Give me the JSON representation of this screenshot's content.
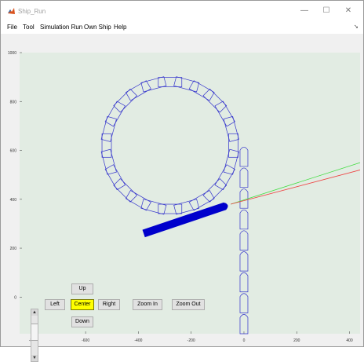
{
  "window": {
    "title": "Ship_Run",
    "controls": {
      "minimize": "—",
      "maximize": "☐",
      "close": "✕"
    }
  },
  "menu": {
    "items": [
      "File",
      "Tool",
      "Simulation Run",
      "Own Ship",
      "Help"
    ],
    "toolbar_arrow": "➘"
  },
  "controls": {
    "up": "Up",
    "left": "Left",
    "center": "Center",
    "right": "Right",
    "down": "Down",
    "zoom_in": "Zoom In",
    "zoom_out": "Zoom Out",
    "active": "center"
  },
  "colors": {
    "plot_bg": "#e2ece3",
    "track": "#3333cc",
    "ship": "#0000cc",
    "heading_green": "#44dd44",
    "heading_red": "#ee4444",
    "center_button": "#ffff00"
  },
  "chart_data": {
    "type": "line",
    "x_ticks": [
      "-800",
      "-600",
      "-400",
      "-200",
      "0",
      "200",
      "400"
    ],
    "y_ticks": [
      "1000",
      "800",
      "600",
      "400",
      "200",
      "0"
    ],
    "xlim": [
      -850,
      440
    ],
    "ylim": [
      -150,
      1000
    ],
    "track": {
      "circle_center": [
        -280,
        620
      ],
      "circle_radius": 240,
      "straight_x": 0,
      "straight_y_range": [
        -150,
        620
      ]
    },
    "ship": {
      "bow": [
        -50,
        380
      ],
      "stern": [
        -380,
        260
      ]
    },
    "heading_lines": [
      {
        "color": "green",
        "to": [
          440,
          550
        ]
      },
      {
        "color": "red",
        "to": [
          440,
          520
        ]
      }
    ]
  }
}
